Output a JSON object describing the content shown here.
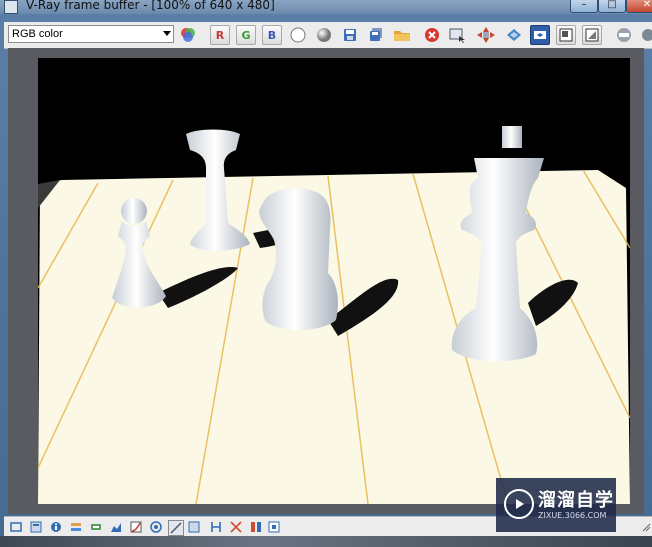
{
  "window": {
    "title": "V-Ray frame buffer - [100% of 640 x 480]",
    "buttons": {
      "minimize": "–",
      "maximize": "□",
      "close": "✕"
    }
  },
  "toolbar": {
    "channel_select": {
      "value": "RGB color"
    },
    "buttons": [
      {
        "name": "color-channels-icon"
      },
      {
        "name": "red-channel-toggle",
        "label": "R"
      },
      {
        "name": "green-channel-toggle",
        "label": "G"
      },
      {
        "name": "blue-channel-toggle",
        "label": "B"
      },
      {
        "name": "view-mono-white-icon"
      },
      {
        "name": "view-mono-gray-icon"
      },
      {
        "name": "save-image-icon"
      },
      {
        "name": "save-all-icon"
      },
      {
        "name": "load-image-icon"
      },
      {
        "name": "clear-image-icon"
      },
      {
        "name": "duplicate-to-max-icon"
      },
      {
        "name": "track-mouse-icon"
      },
      {
        "name": "region-render-icon"
      },
      {
        "name": "link-to-render-icon"
      },
      {
        "name": "render-last-icon"
      },
      {
        "name": "show-correction-icon"
      },
      {
        "name": "lens-effects-icon"
      }
    ]
  },
  "statusbar": {
    "icons": [
      "window-icon",
      "history-icon",
      "info-icon",
      "layers-icon",
      "lut-icon",
      "levels-icon",
      "curve-icon",
      "target-icon",
      "compare-icon",
      "zoom-icon",
      "h-compare-icon",
      "hist-icon",
      "split-icon",
      "stop-icon"
    ]
  },
  "render": {
    "colors": {
      "floor": "#fbf8e6",
      "grid_line": "#e6b84a",
      "piece": "#f1f4f7",
      "background": "#000000"
    }
  },
  "watermark": {
    "title": "溜溜自学",
    "subtitle": "ZIXUE.3066.COM"
  }
}
